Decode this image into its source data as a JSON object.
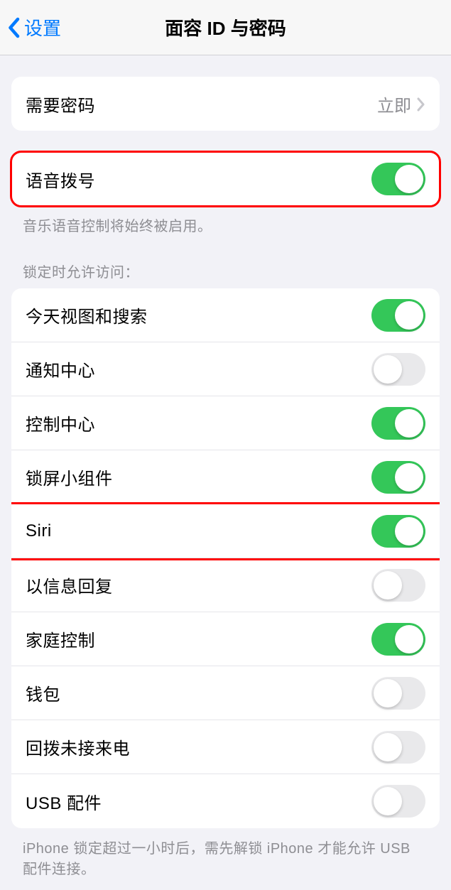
{
  "nav": {
    "back_label": "设置",
    "title": "面容 ID 与密码"
  },
  "require_passcode": {
    "label": "需要密码",
    "value": "立即"
  },
  "voice_dial": {
    "label": "语音拨号",
    "enabled": true,
    "footer": "音乐语音控制将始终被启用。"
  },
  "lock_access": {
    "header": "锁定时允许访问：",
    "items": [
      {
        "label": "今天视图和搜索",
        "enabled": true
      },
      {
        "label": "通知中心",
        "enabled": false
      },
      {
        "label": "控制中心",
        "enabled": true
      },
      {
        "label": "锁屏小组件",
        "enabled": true
      },
      {
        "label": "Siri",
        "enabled": true
      },
      {
        "label": "以信息回复",
        "enabled": false
      },
      {
        "label": "家庭控制",
        "enabled": true
      },
      {
        "label": "钱包",
        "enabled": false
      },
      {
        "label": "回拨未接来电",
        "enabled": false
      },
      {
        "label": "USB 配件",
        "enabled": false
      }
    ],
    "footer": "iPhone 锁定超过一小时后，需先解锁 iPhone 才能允许 USB 配件连接。"
  }
}
